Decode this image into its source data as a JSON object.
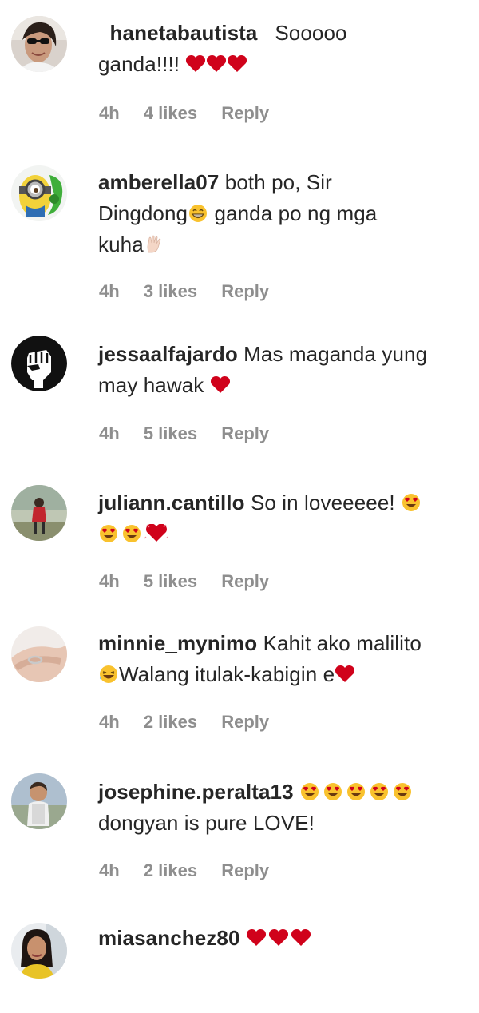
{
  "comments": [
    {
      "username": "_hanetabautista_",
      "text": "Sooooo ganda!!!!",
      "line2": "ganda!!!!",
      "line1_text": "Sooooo",
      "time": "4h",
      "likes": "4 likes",
      "reply": "Reply",
      "avatar": "woman-sunglasses-photo"
    },
    {
      "username": "amberella07",
      "line1_text": "both po, Sir",
      "line2": "Dingdong",
      "line2_after": "ganda po ng mga",
      "line3": "kuha",
      "time": "4h",
      "likes": "3 likes",
      "reply": "Reply",
      "avatar": "minion-photo"
    },
    {
      "username": "jessaalfajardo",
      "line1_text": "Mas maganda yung",
      "line2": "may hawak",
      "time": "4h",
      "likes": "5 likes",
      "reply": "Reply",
      "avatar": "raised-fist-icon"
    },
    {
      "username": "juliann.cantillo",
      "line1_text": "So in loveeeee!",
      "time": "4h",
      "likes": "5 likes",
      "reply": "Reply",
      "avatar": "person-outdoor-photo"
    },
    {
      "username": "minnie_mynimo",
      "line1_text": "Kahit ako malilito",
      "line2": "Walang itulak-kabigin e",
      "time": "4h",
      "likes": "2 likes",
      "reply": "Reply",
      "avatar": "hand-ring-photo"
    },
    {
      "username": "josephine.peralta13",
      "line2": "dongyan is pure LOVE!",
      "time": "4h",
      "likes": "2 likes",
      "reply": "Reply",
      "avatar": "child-photo"
    },
    {
      "username": "miasanchez80",
      "avatar": "woman-selfie-photo"
    }
  ],
  "colors": {
    "text": "#262626",
    "meta": "#8e8e8e",
    "heart": "#d0021b",
    "emoji_face": "#f9c22e"
  }
}
